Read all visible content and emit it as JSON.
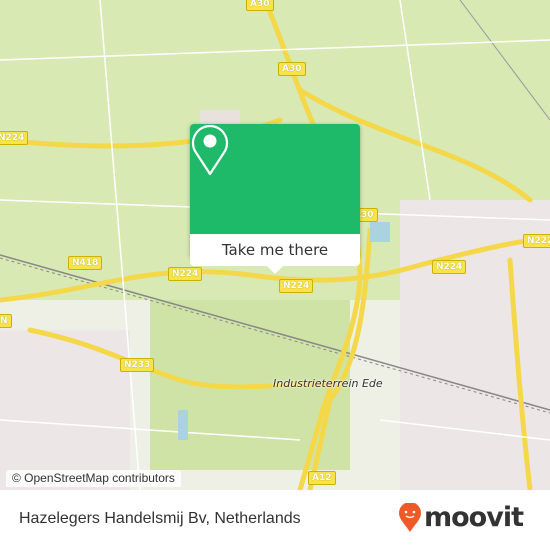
{
  "map": {
    "road_labels": [
      "A30",
      "A30",
      "N224",
      "A30",
      "N222",
      "N418",
      "N224",
      "N224",
      "N224",
      "N233",
      "A12",
      "N"
    ],
    "place_labels": [
      "Industrieterrein Ede"
    ],
    "attribution": "© OpenStreetMap contributors",
    "colors": {
      "land": "#d8e9b4",
      "road": "#f5d84a",
      "urban": "#ece6e6",
      "water": "#aad3df"
    }
  },
  "popup": {
    "icon": "map-pin-icon",
    "button_label": "Take me there",
    "color": "#1fba69"
  },
  "footer": {
    "title": "Hazelegers Handelsmij Bv, Netherlands",
    "logo_text": "moovit",
    "logo_color": "#f05a28"
  }
}
